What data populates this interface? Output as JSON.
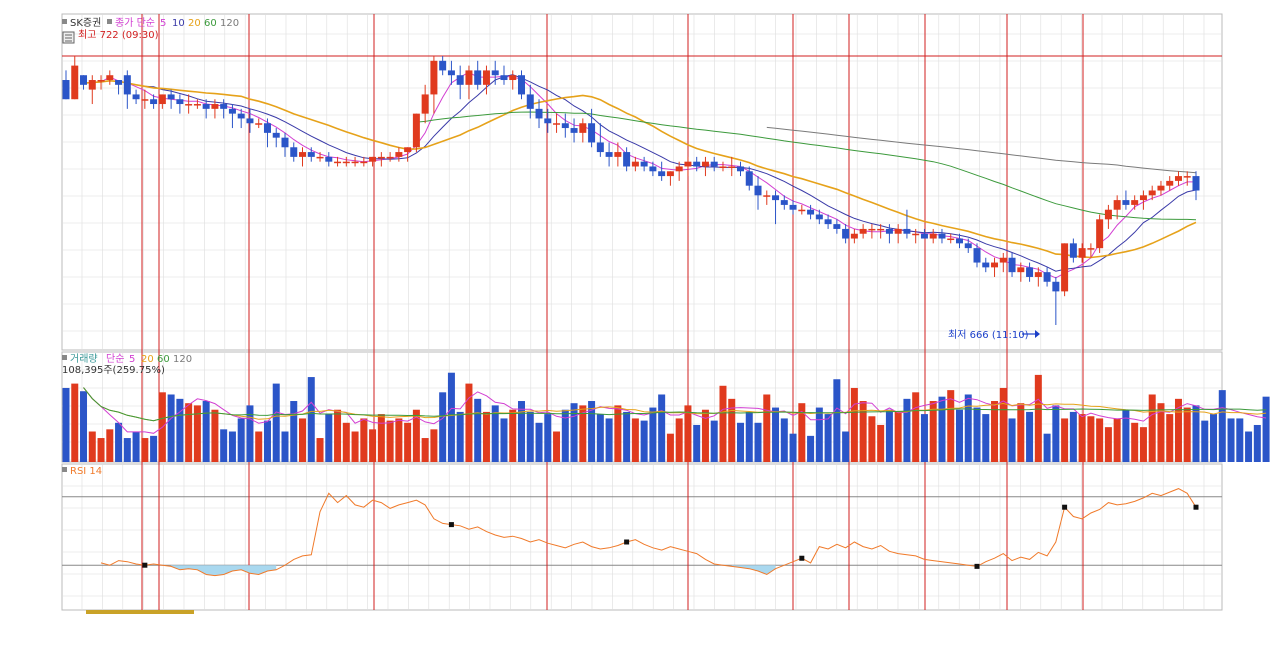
{
  "price_panel": {
    "stock_name": "SK증권",
    "ma_title": "종가 단순",
    "ma_periods": [
      "5",
      "10",
      "20",
      "60",
      "120"
    ],
    "high_label": "최고 722 (09:30)",
    "low_label": "최저 666 (11:10)"
  },
  "volume_panel": {
    "title": "거래량",
    "ma_title": "단순",
    "ma_periods": [
      "5",
      "20",
      "60",
      "120"
    ],
    "value_label": "108,395주(259.75%)"
  },
  "rsi_panel": {
    "title": "RSI 14"
  },
  "colors": {
    "up": "#e03a1e",
    "down": "#2b55c8",
    "ma5": "#d23fd2",
    "ma10": "#3a3aa8",
    "ma20": "#e6a21a",
    "ma60": "#3c9a3c",
    "ma120": "#7a7a7a",
    "rsi": "#f07a2a",
    "rsi_fill": "#a9d8ef",
    "session_line": "#d21f1f",
    "grid": "#dddddd",
    "high_low_text_high": "#d21f1f",
    "high_low_text_low": "#1a3ec8"
  },
  "chart_data": [
    {
      "type": "candlestick",
      "title": "SK증권",
      "ylim": [
        666,
        722
      ],
      "max_price": 722,
      "max_time": "09:30",
      "min_price": 666,
      "min_time": "11:10",
      "candles": [
        [
          717,
          719,
          713,
          713
        ],
        [
          713,
          722,
          713,
          720
        ],
        [
          718,
          718,
          715,
          716
        ],
        [
          715,
          718,
          712,
          717
        ],
        [
          717,
          718,
          715,
          717
        ],
        [
          717,
          719,
          716,
          718
        ],
        [
          717,
          717,
          714,
          716
        ],
        [
          718,
          719,
          711,
          714
        ],
        [
          714,
          715,
          712,
          713
        ],
        [
          713,
          715,
          711,
          713
        ],
        [
          713,
          714,
          711,
          712
        ],
        [
          712,
          714,
          711,
          714
        ],
        [
          714,
          715,
          711,
          713
        ],
        [
          713,
          714,
          710,
          712
        ],
        [
          712,
          714,
          710,
          712
        ],
        [
          712,
          713,
          711,
          712
        ],
        [
          712,
          713,
          709,
          711
        ],
        [
          711,
          713,
          709,
          712
        ],
        [
          712,
          713,
          709,
          711
        ],
        [
          711,
          712,
          707,
          710
        ],
        [
          710,
          711,
          707,
          709
        ],
        [
          709,
          711,
          706,
          708
        ],
        [
          708,
          709,
          707,
          708
        ],
        [
          708,
          709,
          703,
          706
        ],
        [
          706,
          707,
          703,
          705
        ],
        [
          705,
          706,
          701,
          703
        ],
        [
          703,
          704,
          700,
          701
        ],
        [
          701,
          703,
          699,
          702
        ],
        [
          702,
          703,
          700,
          701
        ],
        [
          701,
          702,
          700,
          701
        ],
        [
          701,
          702,
          699,
          700
        ],
        [
          700,
          701,
          699,
          700
        ],
        [
          700,
          701,
          699,
          700
        ],
        [
          700,
          701,
          699,
          700
        ],
        [
          700,
          701,
          699,
          700
        ],
        [
          700,
          701,
          699,
          701
        ],
        [
          701,
          702,
          699,
          701
        ],
        [
          701,
          702,
          700,
          701
        ],
        [
          701,
          703,
          700,
          702
        ],
        [
          702,
          703,
          700,
          703
        ],
        [
          703,
          710,
          702,
          710
        ],
        [
          710,
          716,
          708,
          714
        ],
        [
          714,
          722,
          710,
          721
        ],
        [
          721,
          722,
          718,
          719
        ],
        [
          719,
          721,
          716,
          718
        ],
        [
          718,
          720,
          713,
          716
        ],
        [
          716,
          720,
          713,
          719
        ],
        [
          719,
          721,
          715,
          716
        ],
        [
          716,
          720,
          714,
          719
        ],
        [
          719,
          721,
          716,
          718
        ],
        [
          718,
          720,
          716,
          717
        ],
        [
          717,
          719,
          715,
          718
        ],
        [
          718,
          719,
          713,
          714
        ],
        [
          714,
          716,
          709,
          711
        ],
        [
          711,
          713,
          707,
          709
        ],
        [
          709,
          711,
          706,
          708
        ],
        [
          708,
          710,
          706,
          708
        ],
        [
          708,
          710,
          705,
          707
        ],
        [
          707,
          709,
          704,
          706
        ],
        [
          706,
          709,
          704,
          708
        ],
        [
          708,
          711,
          703,
          704
        ],
        [
          704,
          708,
          701,
          702
        ],
        [
          702,
          704,
          699,
          701
        ],
        [
          701,
          704,
          699,
          702
        ],
        [
          702,
          703,
          698,
          699
        ],
        [
          699,
          701,
          698,
          700
        ],
        [
          700,
          701,
          698,
          699
        ],
        [
          699,
          700,
          697,
          698
        ],
        [
          698,
          700,
          696,
          697
        ],
        [
          697,
          698,
          695,
          698
        ],
        [
          698,
          700,
          696,
          699
        ],
        [
          699,
          701,
          697,
          700
        ],
        [
          700,
          701,
          698,
          699
        ],
        [
          699,
          701,
          697,
          700
        ],
        [
          700,
          701,
          698,
          699
        ],
        [
          699,
          700,
          698,
          699
        ],
        [
          699,
          701,
          697,
          699
        ],
        [
          699,
          700,
          697,
          698
        ],
        [
          698,
          699,
          694,
          695
        ],
        [
          695,
          697,
          690,
          693
        ],
        [
          693,
          694,
          691,
          693
        ],
        [
          693,
          694,
          687,
          692
        ],
        [
          692,
          693,
          690,
          691
        ],
        [
          691,
          692,
          689,
          690
        ],
        [
          690,
          691,
          689,
          690
        ],
        [
          690,
          691,
          688,
          689
        ],
        [
          689,
          690,
          687,
          688
        ],
        [
          688,
          689,
          686,
          687
        ],
        [
          687,
          688,
          685,
          686
        ],
        [
          686,
          687,
          683,
          684
        ],
        [
          684,
          686,
          683,
          685
        ],
        [
          685,
          687,
          684,
          686
        ],
        [
          686,
          687,
          684,
          686
        ],
        [
          686,
          687,
          684,
          686
        ],
        [
          686,
          687,
          683,
          685
        ],
        [
          685,
          687,
          683,
          686
        ],
        [
          686,
          690,
          684,
          685
        ],
        [
          685,
          686,
          683,
          685
        ],
        [
          685,
          686,
          684,
          684
        ],
        [
          684,
          686,
          683,
          685
        ],
        [
          685,
          686,
          683,
          684
        ],
        [
          684,
          685,
          683,
          684
        ],
        [
          684,
          685,
          682,
          683
        ],
        [
          683,
          684,
          681,
          682
        ],
        [
          682,
          683,
          678,
          679
        ],
        [
          679,
          680,
          677,
          678
        ],
        [
          678,
          680,
          676,
          679
        ],
        [
          679,
          681,
          677,
          680
        ],
        [
          680,
          681,
          676,
          677
        ],
        [
          677,
          679,
          675,
          678
        ],
        [
          678,
          679,
          675,
          676
        ],
        [
          676,
          678,
          674,
          677
        ],
        [
          677,
          678,
          674,
          675
        ],
        [
          675,
          676,
          666,
          673
        ],
        [
          673,
          683,
          672,
          683
        ],
        [
          683,
          684,
          679,
          680
        ],
        [
          680,
          683,
          679,
          682
        ],
        [
          682,
          683,
          680,
          682
        ],
        [
          682,
          689,
          681,
          688
        ],
        [
          688,
          691,
          686,
          690
        ],
        [
          690,
          693,
          688,
          692
        ],
        [
          692,
          694,
          690,
          691
        ],
        [
          691,
          693,
          690,
          692
        ],
        [
          692,
          694,
          690,
          693
        ],
        [
          693,
          695,
          692,
          694
        ],
        [
          694,
          696,
          693,
          695
        ],
        [
          695,
          697,
          694,
          696
        ],
        [
          696,
          698,
          695,
          697
        ],
        [
          697,
          698,
          695,
          697
        ],
        [
          697,
          698,
          692,
          694
        ]
      ],
      "ma_periods": [
        5,
        10,
        20,
        60,
        120
      ]
    },
    {
      "type": "bar",
      "title": "거래량",
      "value_label": "108,395주(259.75%)",
      "volume_index": [
        68,
        72,
        65,
        28,
        22,
        30,
        36,
        22,
        28,
        22,
        24,
        64,
        62,
        58,
        54,
        52,
        56,
        48,
        30,
        28,
        40,
        52,
        28,
        38,
        72,
        28,
        56,
        40,
        78,
        22,
        44,
        48,
        36,
        28,
        40,
        30,
        44,
        38,
        40,
        36,
        48,
        22,
        30,
        64,
        82,
        46,
        72,
        58,
        46,
        52,
        40,
        48,
        56,
        46,
        36,
        44,
        28,
        48,
        54,
        52,
        56,
        44,
        40,
        52,
        46,
        40,
        38,
        50,
        62,
        26,
        40,
        52,
        34,
        48,
        38,
        70,
        58,
        36,
        46,
        36,
        62,
        50,
        40,
        26,
        54,
        24,
        50,
        44,
        76,
        28,
        68,
        56,
        42,
        34,
        48,
        46,
        58,
        64,
        44,
        56,
        60,
        66,
        48,
        62,
        50,
        44,
        56,
        68,
        40,
        54,
        46,
        80,
        26,
        52,
        40,
        46,
        44,
        42,
        40,
        32,
        40,
        48,
        36,
        32,
        62,
        54,
        44,
        58,
        50,
        52,
        38,
        44,
        66,
        40,
        40,
        28,
        34,
        60
      ]
    },
    {
      "type": "line",
      "title": "RSI 14",
      "ylim": [
        0,
        100
      ],
      "rsi": [
        32,
        30,
        34,
        33,
        31,
        30,
        31,
        30,
        29,
        26,
        27,
        26,
        22,
        21,
        22,
        25,
        26,
        23,
        22,
        25,
        26,
        30,
        35,
        38,
        39,
        76,
        92,
        84,
        90,
        82,
        80,
        86,
        84,
        79,
        82,
        84,
        86,
        82,
        70,
        66,
        65,
        64,
        61,
        63,
        59,
        56,
        54,
        55,
        53,
        50,
        52,
        49,
        47,
        45,
        48,
        50,
        46,
        44,
        45,
        47,
        50,
        52,
        48,
        45,
        43,
        46,
        44,
        42,
        40,
        35,
        31,
        30,
        29,
        28,
        27,
        25,
        22,
        27,
        30,
        33,
        36,
        32,
        46,
        44,
        48,
        45,
        50,
        46,
        44,
        47,
        42,
        40,
        39,
        38,
        35,
        34,
        33,
        32,
        31,
        30,
        29,
        33,
        36,
        40,
        34,
        37,
        35,
        41,
        38,
        50,
        80,
        72,
        70,
        75,
        78,
        84,
        82,
        83,
        85,
        88,
        92,
        90,
        93,
        96,
        92,
        80
      ]
    }
  ]
}
